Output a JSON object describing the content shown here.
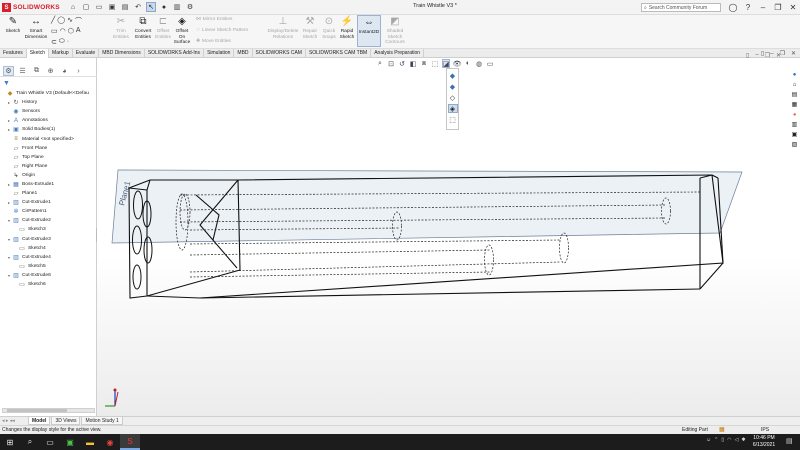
{
  "app": {
    "brand": "SOLIDWORKS",
    "window_title": "Train Whistle V3 *"
  },
  "search": {
    "placeholder": "Search Community Forum"
  },
  "ribbon": {
    "sketch": "Sketch",
    "smart_dimension": "Smart Dimension",
    "mirror_entities": "Mirror Entities",
    "linear_sketch_pattern": "Linear Sketch Pattern",
    "move_entities": "Move Entities",
    "trim_entities": "Trim Entities",
    "convert_entities": "Convert Entities",
    "offset_entities": "Offset Entities",
    "offset_on_surface": "Offset On Surface",
    "display_delete_relations": "Display/Delete Relations",
    "repair_sketch": "Repair Sketch",
    "quick_snaps": "Quick Snaps",
    "rapid_sketch": "Rapid Sketch",
    "instant2d": "Instant2D",
    "shaded_sketch_contours": "Shaded Sketch Contours"
  },
  "tabs": [
    "Features",
    "Sketch",
    "Markup",
    "Evaluate",
    "MBD Dimensions",
    "SOLIDWORKS Add-Ins",
    "Simulation",
    "MBD",
    "SOLIDWORKS CAM",
    "SOLIDWORKS CAM TBM",
    "Analysis Preparation"
  ],
  "active_tab": "Sketch",
  "tree": [
    {
      "label": "Train Whistle V3  (Default<<Defau",
      "indent": 0,
      "expand": "",
      "icon": "part-icon"
    },
    {
      "label": "History",
      "indent": 1,
      "expand": "▸",
      "icon": "history-icon"
    },
    {
      "label": "Sensors",
      "indent": 1,
      "expand": "",
      "icon": "sensors-icon"
    },
    {
      "label": "Annotations",
      "indent": 1,
      "expand": "▸",
      "icon": "annotations-icon"
    },
    {
      "label": "Solid Bodies(1)",
      "indent": 1,
      "expand": "▸",
      "icon": "solid-bodies-icon"
    },
    {
      "label": "Material <not specified>",
      "indent": 1,
      "expand": "",
      "icon": "material-icon"
    },
    {
      "label": "Front Plane",
      "indent": 1,
      "expand": "",
      "icon": "plane-icon"
    },
    {
      "label": "Top Plane",
      "indent": 1,
      "expand": "",
      "icon": "plane-icon"
    },
    {
      "label": "Right Plane",
      "indent": 1,
      "expand": "",
      "icon": "plane-icon"
    },
    {
      "label": "Origin",
      "indent": 1,
      "expand": "",
      "icon": "origin-icon"
    },
    {
      "label": "Boss-Extrude1",
      "indent": 1,
      "expand": "▸",
      "icon": "extrude-icon"
    },
    {
      "label": "Plane1",
      "indent": 1,
      "expand": "",
      "icon": "plane-icon"
    },
    {
      "label": "Cut-Extrude1",
      "indent": 1,
      "expand": "▸",
      "icon": "cut-icon"
    },
    {
      "label": "CirPattern1",
      "indent": 1,
      "expand": "",
      "icon": "pattern-icon"
    },
    {
      "label": "Cut-Extrude2",
      "indent": 1,
      "expand": "▾",
      "icon": "cut-icon"
    },
    {
      "label": "Sketch3",
      "indent": 2,
      "expand": "",
      "icon": "sketch-icon"
    },
    {
      "label": "Cut-Extrude3",
      "indent": 1,
      "expand": "▾",
      "icon": "cut-icon"
    },
    {
      "label": "Sketch4",
      "indent": 2,
      "expand": "",
      "icon": "sketch-icon"
    },
    {
      "label": "Cut-Extrude4",
      "indent": 1,
      "expand": "▾",
      "icon": "cut-icon"
    },
    {
      "label": "Sketch5",
      "indent": 2,
      "expand": "",
      "icon": "sketch-icon"
    },
    {
      "label": "Cut-Extrude6",
      "indent": 1,
      "expand": "▾",
      "icon": "cut-icon"
    },
    {
      "label": "Sketch6",
      "indent": 2,
      "expand": "",
      "icon": "sketch-icon"
    }
  ],
  "viewport": {
    "plane_label": "Plane1"
  },
  "bottom_tabs": [
    "Model",
    "3D Views",
    "Motion Study 1"
  ],
  "status": {
    "message": "Changes the display style for the active view.",
    "mode": "Editing Part",
    "units": "IPS"
  },
  "clock": {
    "time": "10:46 PM",
    "date": "6/13/2021"
  }
}
